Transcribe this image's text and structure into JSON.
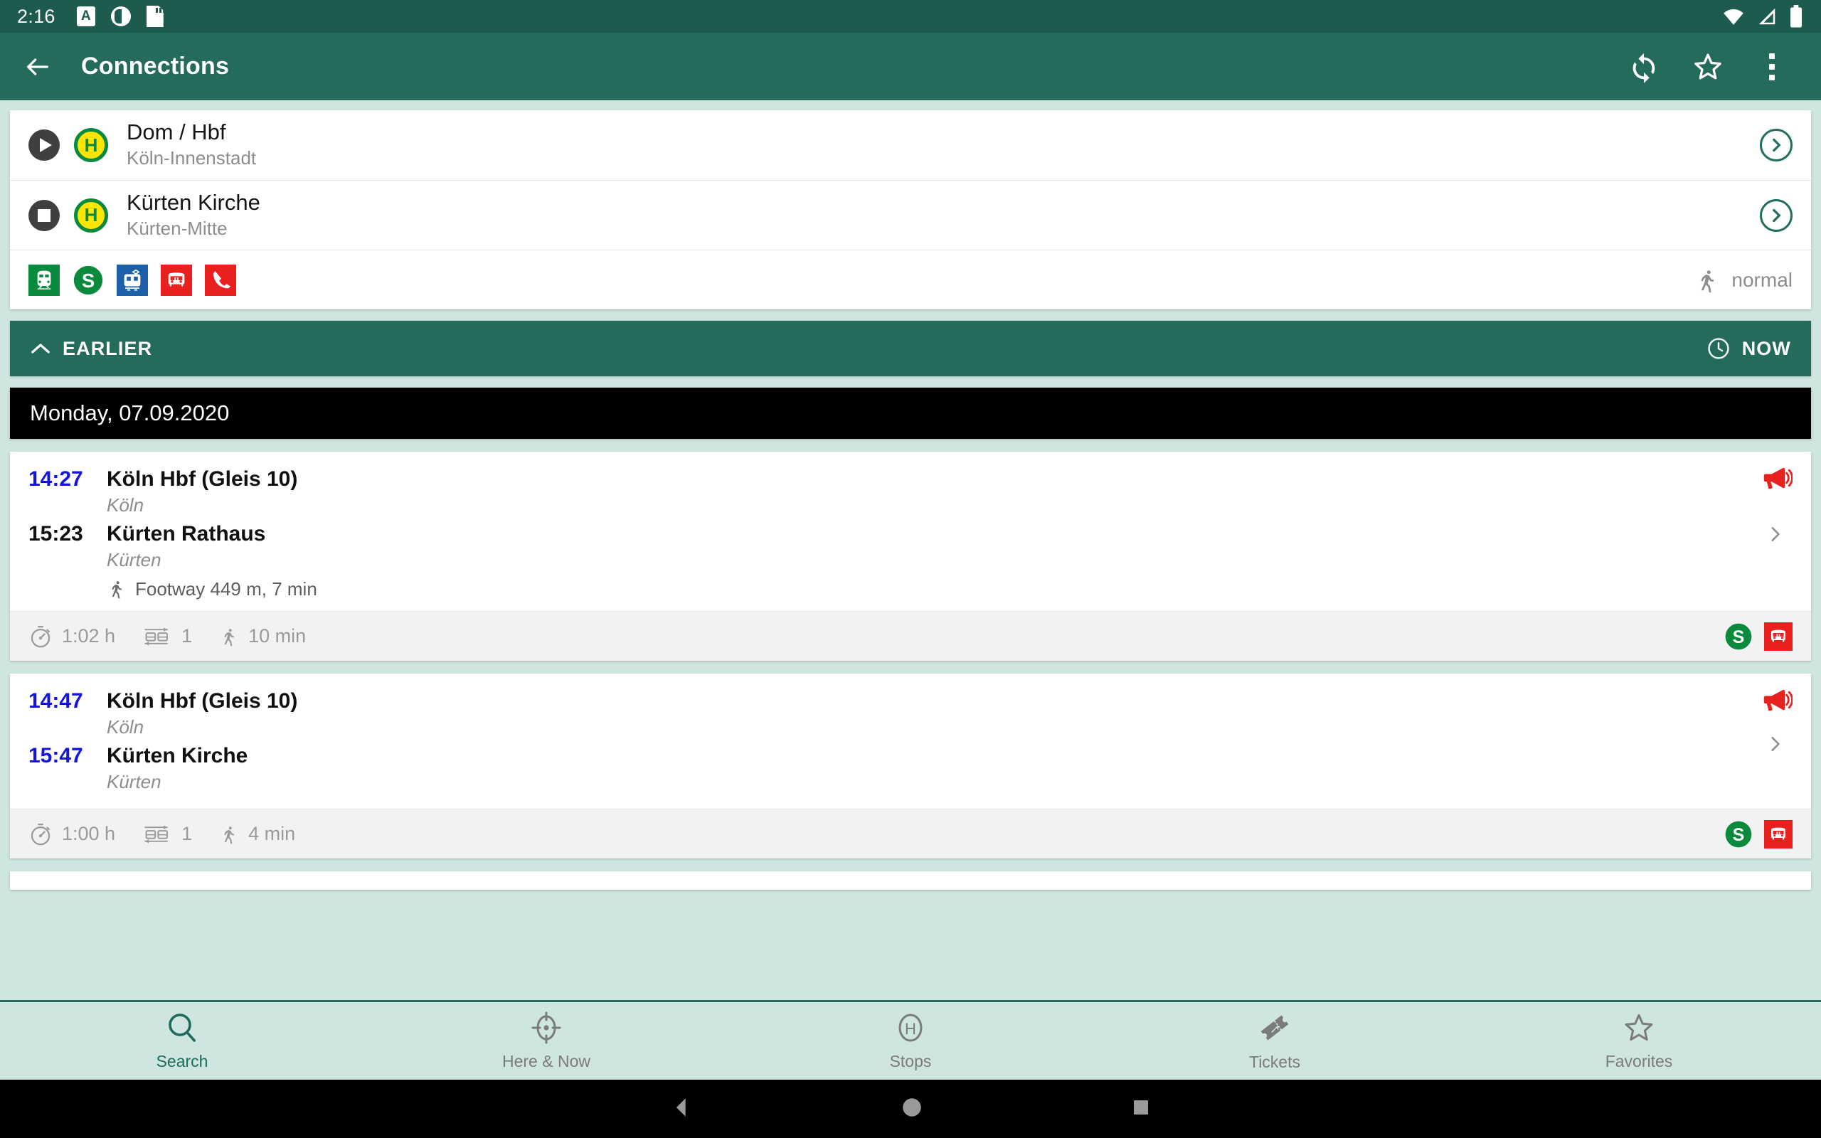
{
  "status_bar": {
    "time": "2:16",
    "left_icons": [
      "alarm-a-icon",
      "do-not-disturb-icon",
      "sd-card-icon"
    ],
    "right_icons": [
      "wifi-icon",
      "signal-icon",
      "battery-icon"
    ]
  },
  "app_bar": {
    "back_label": "back-arrow",
    "title": "Connections",
    "actions": [
      {
        "name": "refresh-button",
        "label": "Refresh"
      },
      {
        "name": "favorite-button",
        "label": "Favorite"
      },
      {
        "name": "overflow-menu-button",
        "label": "More options"
      }
    ]
  },
  "query_card": {
    "origin": {
      "name": "Dom / Hbf",
      "sub": "Köln-Innenstadt",
      "marker": "play-triangle-icon",
      "stop_badge": "H"
    },
    "destination": {
      "name": "Kürten Kirche",
      "sub": "Kürten-Mitte",
      "marker": "stop-square-icon",
      "stop_badge": "H"
    },
    "modes": [
      {
        "name": "train-icon",
        "color": "#0a8a3c"
      },
      {
        "name": "s-bahn-icon",
        "color": "#0a8a3c"
      },
      {
        "name": "tram-icon",
        "color": "#1d5fa8"
      },
      {
        "name": "bus-icon",
        "color": "#e8211f"
      },
      {
        "name": "call-bus-icon",
        "color": "#e8211f"
      }
    ],
    "walk_speed": "normal"
  },
  "time_bar": {
    "earlier_label": "EARLIER",
    "now_label": "NOW"
  },
  "date_header": "Monday, 07.09.2020",
  "connections": [
    {
      "departure_time": "14:27",
      "departure_time_color": "blue",
      "departure_stop": "Köln Hbf (Gleis 10)",
      "departure_city": "Köln",
      "arrival_time": "15:23",
      "arrival_time_color": "black",
      "arrival_stop": "Kürten Rathaus",
      "arrival_city": "Kürten",
      "footway": "Footway 449 m, 7 min",
      "duration": "1:02 h",
      "changes": "1",
      "walk_time": "10 min",
      "has_alert": true,
      "modes": [
        {
          "name": "s-bahn-icon",
          "color": "#0a8a3c"
        },
        {
          "name": "bus-icon",
          "color": "#e8211f"
        }
      ]
    },
    {
      "departure_time": "14:47",
      "departure_time_color": "blue",
      "departure_stop": "Köln Hbf (Gleis 10)",
      "departure_city": "Köln",
      "arrival_time": "15:47",
      "arrival_time_color": "blue",
      "arrival_stop": "Kürten Kirche",
      "arrival_city": "Kürten",
      "footway": "",
      "duration": "1:00 h",
      "changes": "1",
      "walk_time": "4 min",
      "has_alert": true,
      "modes": [
        {
          "name": "s-bahn-icon",
          "color": "#0a8a3c"
        },
        {
          "name": "bus-icon",
          "color": "#e8211f"
        }
      ]
    }
  ],
  "bottom_nav": [
    {
      "label": "Search",
      "icon": "search-icon",
      "active": true
    },
    {
      "label": "Here & Now",
      "icon": "crosshair-icon",
      "active": false
    },
    {
      "label": "Stops",
      "icon": "stop-h-icon",
      "active": false
    },
    {
      "label": "Tickets",
      "icon": "ticket-icon",
      "active": false
    },
    {
      "label": "Favorites",
      "icon": "star-icon",
      "active": false
    }
  ],
  "android_nav": [
    "back-triangle-icon",
    "home-circle-icon",
    "recents-square-icon"
  ],
  "colors": {
    "primary": "#246b5c",
    "status_bar": "#1d5b4e",
    "background": "#cfe5e0",
    "time_blue": "#1414e0",
    "alert_red": "#e8211f"
  }
}
